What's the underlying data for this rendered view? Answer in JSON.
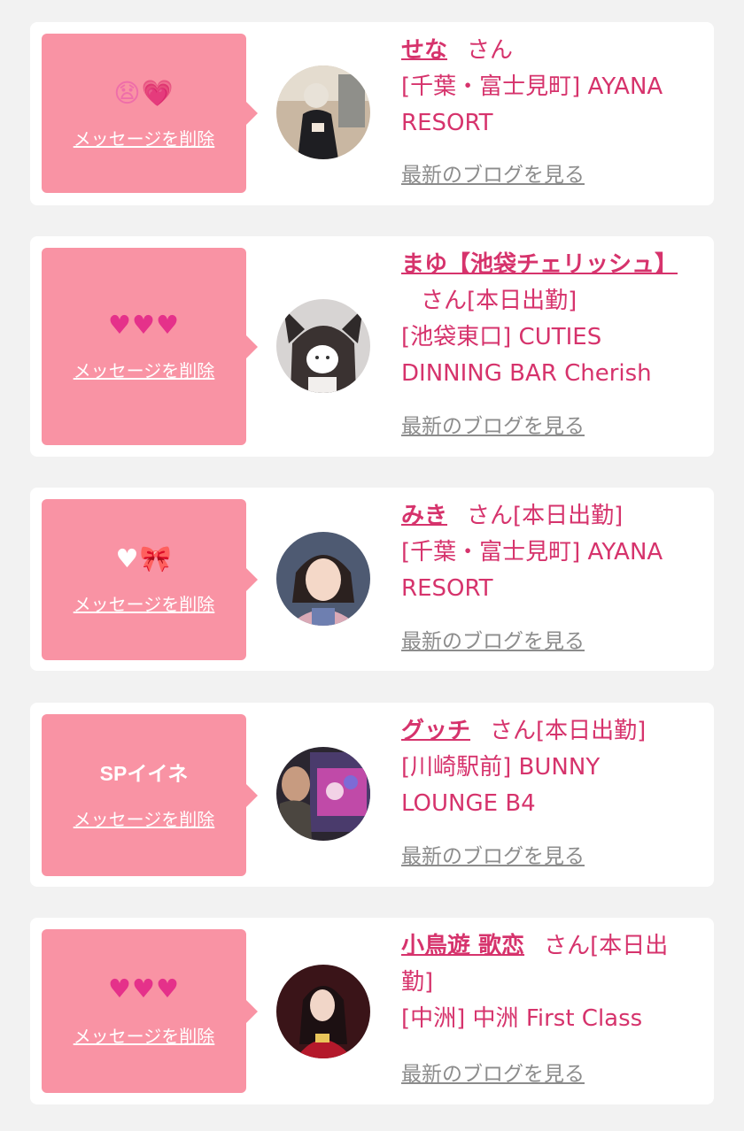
{
  "colors": {
    "page_bg": "#f2f2f2",
    "card_bg": "#ffffff",
    "bubble_bg": "#f993a4",
    "name_color": "#d6336c",
    "blog_link_color": "#8c8c8c"
  },
  "delete_label": "メッセージを削除",
  "blog_label": "最新のブログを見る",
  "items": [
    {
      "stamp": [
        "sneezing-face-emoji",
        "growing-heart-emoji"
      ],
      "name": "せな",
      "suffix": "さん",
      "shop": "[千葉・富士見町] AYANA RESORT",
      "avatar": "girl-in-black-outfit-photo"
    },
    {
      "stamp": [
        "pink-heart-emoji",
        "pink-heart-emoji",
        "pink-heart-emoji"
      ],
      "name": "まゆ【池袋チェリッシュ】",
      "suffix": "さん[本日出勤]",
      "shop": "[池袋東口] CUTIES DINNING BAR Cherish",
      "avatar": "girl-with-cat-ears-photo"
    },
    {
      "stamp": [
        "white-heart-emoji",
        "ribbon-emoji"
      ],
      "name": "みき",
      "suffix": "さん[本日出勤]",
      "shop": "[千葉・富士見町] AYANA RESORT",
      "avatar": "girl-in-yukata-photo"
    },
    {
      "stamp_text": "SPイイネ",
      "name": "グッチ",
      "suffix": "さん[本日出勤]",
      "shop": "[川崎駅前] BUNNY LOUNGE B4",
      "avatar": "man-at-arcade-photo"
    },
    {
      "stamp": [
        "sparkling-heart-emoji",
        "sparkling-heart-emoji",
        "sparkling-heart-emoji"
      ],
      "name": "小鳥遊 歌恋",
      "suffix": "さん[本日出勤]",
      "shop": "[中洲] 中洲 First Class",
      "avatar": "girl-in-red-dress-photo"
    }
  ]
}
